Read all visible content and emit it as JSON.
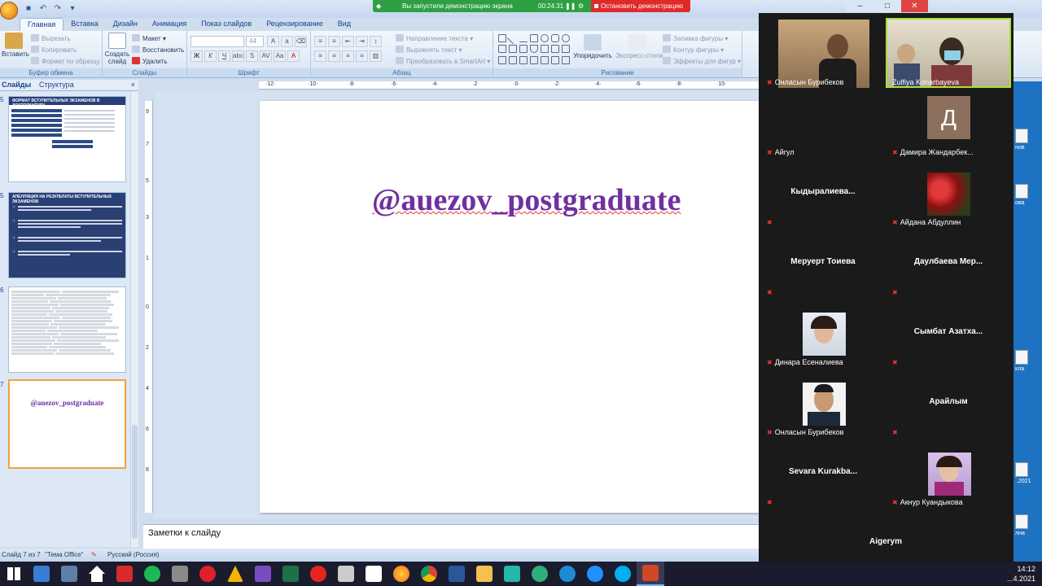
{
  "app": {
    "tabs": [
      "Главная",
      "Вставка",
      "Дизайн",
      "Анимация",
      "Показ слайдов",
      "Рецензирование",
      "Вид"
    ],
    "active_tab": "Главная"
  },
  "ribbon": {
    "clipboard": {
      "title": "Буфер обмена",
      "paste": "Вставить",
      "cut": "Вырезать",
      "copy": "Копировать",
      "format_painter": "Формат по образцу"
    },
    "slides": {
      "title": "Слайды",
      "new_slide": "Создать слайд",
      "layout": "Макет",
      "reset": "Восстановить",
      "delete": "Удалить"
    },
    "font": {
      "title": "Шрифт",
      "size": "44"
    },
    "paragraph": {
      "title": "Абзац",
      "text_direction": "Направление текста",
      "align_text": "Выровнять текст",
      "smartart": "Преобразовать в SmartArt"
    },
    "drawing": {
      "title": "Рисование",
      "arrange": "Упорядочить",
      "quick_styles": "Экспресс-стили",
      "fill": "Заливка фигуры",
      "outline": "Контур фигуры",
      "effects": "Эффекты для фигур"
    }
  },
  "left_pane": {
    "tab_slides": "Слайды",
    "tab_outline": "Структура",
    "close": "×",
    "thumbs": [
      {
        "num": "5",
        "title": "ФОРМАТ ВСТУПИТЕЛЬНЫХ ЭКЗАМЕНОВ В ДОКТОРАНТУРУ"
      },
      {
        "num": "5",
        "title": "АПЕЛЛЯЦИЯ НА РЕЗУЛЬТАТЫ ВСТУПИТЕЛЬНЫХ ЭКЗАМЕНОВ"
      },
      {
        "num": "6",
        "title": ""
      },
      {
        "num": "7",
        "title": "@auezov_postgraduate"
      }
    ]
  },
  "slide": {
    "title": "@auezov_postgraduate"
  },
  "notes": {
    "placeholder": "Заметки к слайду"
  },
  "statusbar": {
    "slide_info": "Слайд 7 из 7",
    "theme": "\"Тема Office\"",
    "language": "Русский (Россия)"
  },
  "share_banner": {
    "text": "Вы запустили демонстрацию экрана",
    "timer": "00:24:31",
    "stop": "Остановить демонстрацию"
  },
  "window_controls": {
    "minimize": "–",
    "restore": "□",
    "close": "✕"
  },
  "zoom": {
    "participants": [
      {
        "name": "Онласын Бурибеков",
        "display": "",
        "kind": "video"
      },
      {
        "name": "Zulfiya Konarbayeva",
        "display": "",
        "kind": "video"
      },
      {
        "name": "Айгул",
        "display": "",
        "kind": "blank"
      },
      {
        "name": "Дамира Жандарбек...",
        "display": "Д",
        "kind": "letter"
      },
      {
        "name": "",
        "display": "Кыдыралиева...",
        "kind": "text"
      },
      {
        "name": "Айдана Абдуллин",
        "display": "",
        "kind": "photo-roses"
      },
      {
        "name": "",
        "display": "Меруерт Тоиева",
        "kind": "text"
      },
      {
        "name": "",
        "display": "Даулбаева Мер...",
        "kind": "text"
      },
      {
        "name": "Динара Есеналиева",
        "display": "",
        "kind": "photo"
      },
      {
        "name": "",
        "display": "Сымбат Азатха...",
        "kind": "text"
      },
      {
        "name": "Онласын Бурибеков",
        "display": "",
        "kind": "photo"
      },
      {
        "name": "",
        "display": "Арайлым",
        "kind": "text"
      },
      {
        "name": "",
        "display": "Sevara Kurakba...",
        "kind": "text"
      },
      {
        "name": "Акнур Куандыкова",
        "display": "",
        "kind": "photo"
      },
      {
        "name": "",
        "display": "Aigerym",
        "kind": "text"
      }
    ]
  },
  "desktop_icons": [
    {
      "label": "нов"
    },
    {
      "label": "ова"
    },
    {
      "label": "кла"
    },
    {
      "label": "..2021"
    },
    {
      "label": "лна"
    }
  ],
  "taskbar": {
    "clock_time": "14:12",
    "clock_date": "...4.2021"
  },
  "colors": {
    "slide_title": "#7030a0",
    "share_green": "#2ea043",
    "stop_red": "#e02a2a",
    "active_speaker": "#a6e03a"
  }
}
